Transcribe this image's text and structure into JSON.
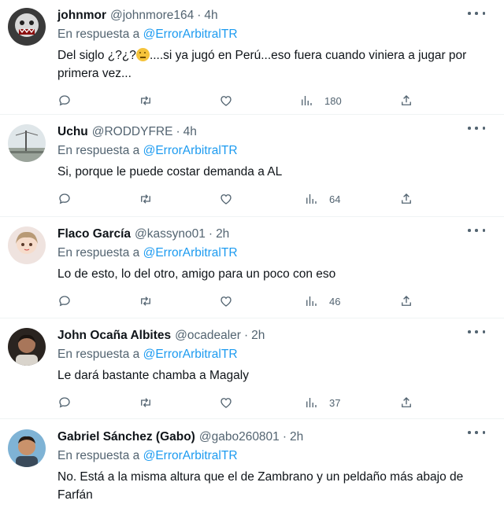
{
  "tweets": [
    {
      "name": "johnmor",
      "handle": "@johnmore164",
      "dot": "·",
      "time": "4h",
      "reply_prefix": "En respuesta a",
      "reply_handle": "@ErrorArbitralTR",
      "text_before_emoji": "Del siglo ¿?¿?",
      "emoji": "thinking-face",
      "text_after_emoji": "....si ya jugó en Perú...eso fuera cuando viniera a jugar por primera vez...",
      "views": "180"
    },
    {
      "name": "Uchu",
      "handle": "@RODDYFRE",
      "dot": "·",
      "time": "4h",
      "reply_prefix": "En respuesta a",
      "reply_handle": "@ErrorArbitralTR",
      "text": "Si, porque le puede costar demanda a AL",
      "views": "64"
    },
    {
      "name": "Flaco García",
      "handle": "@kassyno01",
      "dot": "·",
      "time": "2h",
      "reply_prefix": "En respuesta a",
      "reply_handle": "@ErrorArbitralTR",
      "text": "Lo de esto, lo del otro, amigo para un poco con eso",
      "views": "46"
    },
    {
      "name": "John Ocaña Albites",
      "handle": "@ocadealer",
      "dot": "·",
      "time": "2h",
      "reply_prefix": "En respuesta a",
      "reply_handle": "@ErrorArbitralTR",
      "text": "Le dará bastante chamba a Magaly",
      "views": "37"
    },
    {
      "name": "Gabriel Sánchez (Gabo)",
      "handle": "@gabo260801",
      "dot": "·",
      "time": "2h",
      "reply_prefix": "En respuesta a",
      "reply_handle": "@ErrorArbitralTR",
      "text": "No. Está a la misma altura que el de Zambrano y un peldaño más abajo de Farfán",
      "views": ""
    }
  ],
  "icons": [
    "more-icon",
    "reply-icon",
    "retweet-icon",
    "like-icon",
    "views-icon",
    "share-icon"
  ],
  "colors": {
    "link": "#1d9bf0",
    "secondary": "#536471",
    "text": "#0f1419",
    "divider": "#eff3f4"
  }
}
